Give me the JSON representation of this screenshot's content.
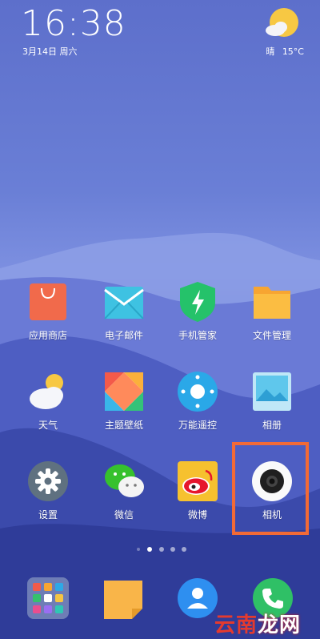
{
  "status_bar": {
    "time": "16:38",
    "date": "3月14日 周六",
    "weather_condition": "晴",
    "temperature": "15°C",
    "weather_icon": "sunny-cloud-icon"
  },
  "apps": [
    {
      "label": "应用商店",
      "icon": "app-store-icon"
    },
    {
      "label": "电子邮件",
      "icon": "email-icon"
    },
    {
      "label": "手机管家",
      "icon": "security-shield-icon"
    },
    {
      "label": "文件管理",
      "icon": "folder-icon"
    },
    {
      "label": "天气",
      "icon": "weather-icon"
    },
    {
      "label": "主题壁纸",
      "icon": "themes-icon"
    },
    {
      "label": "万能遥控",
      "icon": "remote-icon"
    },
    {
      "label": "相册",
      "icon": "gallery-icon"
    },
    {
      "label": "设置",
      "icon": "settings-gear-icon"
    },
    {
      "label": "微信",
      "icon": "wechat-icon"
    },
    {
      "label": "微博",
      "icon": "weibo-icon"
    },
    {
      "label": "相机",
      "icon": "camera-icon"
    }
  ],
  "page_indicator": {
    "pages": 4,
    "current": 1
  },
  "dock": [
    {
      "icon": "app-folder-icon"
    },
    {
      "icon": "notes-icon"
    },
    {
      "icon": "contacts-icon"
    },
    {
      "icon": "phone-icon"
    }
  ],
  "watermark": {
    "text_part1": "云南",
    "text_part2": "龙网"
  },
  "colors": {
    "highlight": "#f26a36"
  }
}
